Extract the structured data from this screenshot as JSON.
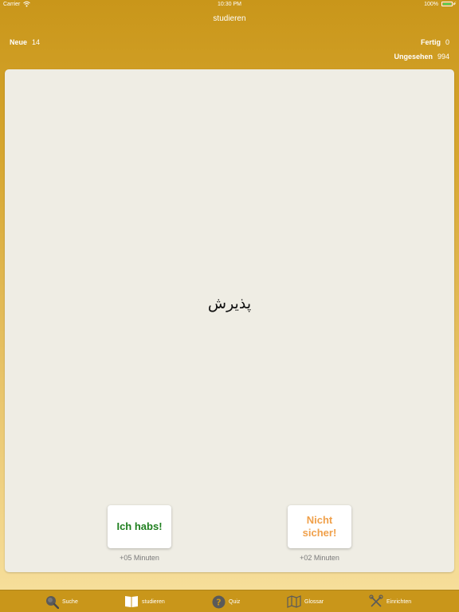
{
  "status_bar": {
    "carrier": "Carrier",
    "time": "10:30 PM",
    "battery": "100%"
  },
  "nav": {
    "title": "studieren"
  },
  "stats": {
    "new_label": "Neue",
    "new_count": "14",
    "done_label": "Fertig",
    "done_count": "0",
    "unseen_label": "Ungesehen",
    "unseen_count": "994"
  },
  "card": {
    "word": "پذیرش"
  },
  "actions": {
    "got_it_label": "Ich habs!",
    "got_it_interval": "+05 Minuten",
    "unsure_label": "Nicht sicher!",
    "unsure_interval": "+02 Minuten"
  },
  "tabs": [
    {
      "label": "Suche",
      "icon": "search-icon"
    },
    {
      "label": "studieren",
      "icon": "book-icon",
      "active": true
    },
    {
      "label": "Quiz",
      "icon": "question-icon"
    },
    {
      "label": "Glossar",
      "icon": "map-icon"
    },
    {
      "label": "Einrichten",
      "icon": "tools-icon"
    }
  ],
  "colors": {
    "accent": "#c9961a",
    "got_it": "#1f7f1f",
    "unsure": "#f0a04a",
    "card": "#efede4"
  }
}
